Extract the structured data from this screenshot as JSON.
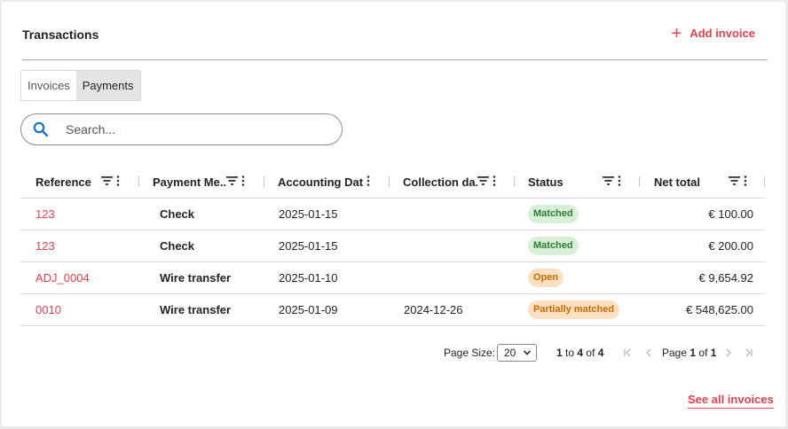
{
  "header": {
    "title": "Transactions",
    "add_label": "Add invoice",
    "accent_color": "#e5404f"
  },
  "tabs": [
    {
      "label": "Invoices",
      "active": false
    },
    {
      "label": "Payments",
      "active": true
    }
  ],
  "search": {
    "placeholder": "Search...",
    "value": ""
  },
  "table": {
    "columns": [
      {
        "label": "Reference"
      },
      {
        "label": "Payment Me..."
      },
      {
        "label": "Accounting Date"
      },
      {
        "label": "Collection da..."
      },
      {
        "label": "Status"
      },
      {
        "label": "Net total"
      }
    ],
    "rows": [
      {
        "reference": "123",
        "payment_method": "Check",
        "accounting_date": "2025-01-15",
        "collection_date": "",
        "status": "Matched",
        "status_color": "green",
        "net_total": "€ 100.00"
      },
      {
        "reference": "123",
        "payment_method": "Check",
        "accounting_date": "2025-01-15",
        "collection_date": "",
        "status": "Matched",
        "status_color": "green",
        "net_total": "€ 200.00"
      },
      {
        "reference": "ADJ_0004",
        "payment_method": "Wire transfer",
        "accounting_date": "2025-01-10",
        "collection_date": "",
        "status": "Open",
        "status_color": "orange",
        "net_total": "€ 9,654.92"
      },
      {
        "reference": "0010",
        "payment_method": "Wire transfer",
        "accounting_date": "2025-01-09",
        "collection_date": "2024-12-26",
        "status": "Partially matched",
        "status_color": "orange",
        "net_total": "€ 548,625.00"
      }
    ]
  },
  "pagination": {
    "page_size_label": "Page Size:",
    "page_size_value": "20",
    "range_from": "1",
    "range_to": "4",
    "total": "4",
    "to_text": "to",
    "of_text": "of",
    "page_label": "Page",
    "page_current": "1",
    "page_of": "of",
    "page_total": "1"
  },
  "footer": {
    "see_all_label": "See all invoices"
  }
}
